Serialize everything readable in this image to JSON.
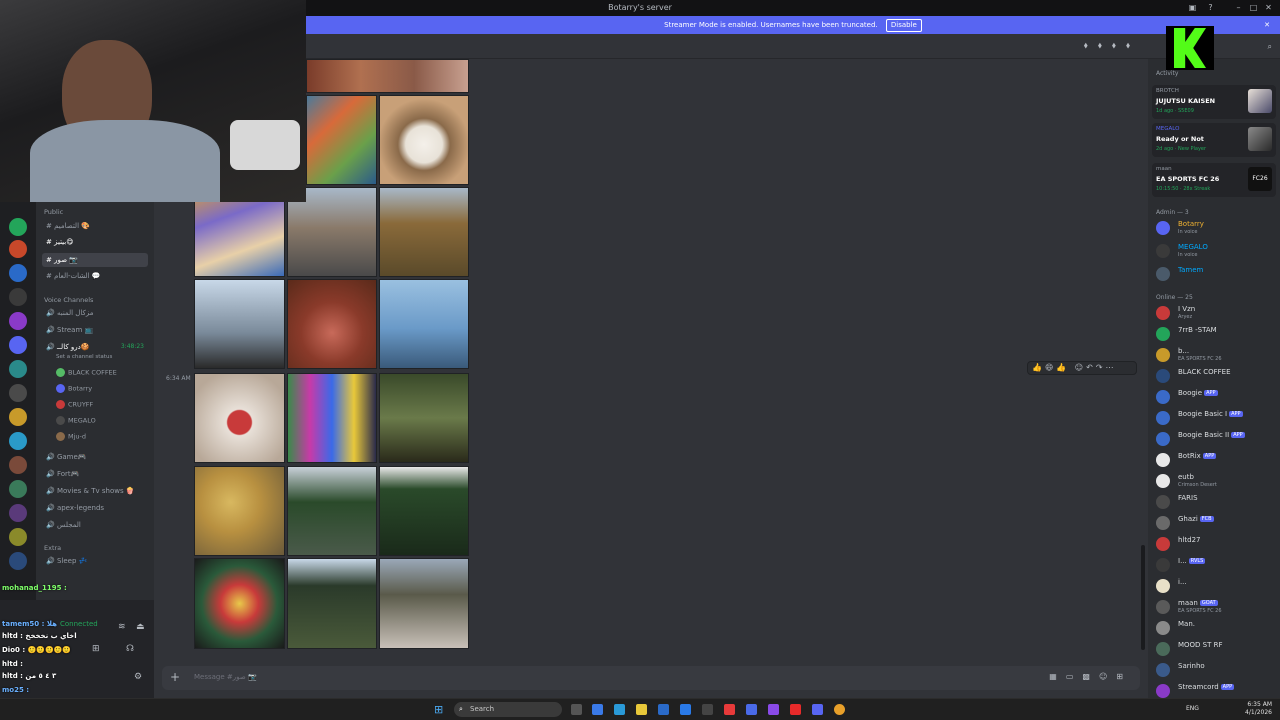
{
  "window": {
    "title": "Botarry's server"
  },
  "banner": {
    "text": "Streamer Mode is enabled. Usernames have been truncated.",
    "button": "Disable"
  },
  "channels": {
    "categories": [
      "Public",
      "Voice Channels",
      "Extra"
    ],
    "text": [
      "التصاميم 🎨",
      "بيتيز😋",
      "صور 📷",
      "الشات-العام 💬"
    ],
    "voice": [
      "مزكال المنبه",
      "Stream 📺",
      "درو كالــ🍪",
      "Game🎮",
      "Fort🎮",
      "Movies & Tv shows 🍿",
      "apex-legends",
      "المجلس",
      "Sleep 💤"
    ],
    "channel_status": "Set a channel status",
    "voice_time": "3:48:23",
    "voice_users": [
      "BLACK COFFEE",
      "Botarry",
      "CRUYFF",
      "MEGALO",
      "Mju-d"
    ]
  },
  "overlay_chat": [
    "mohanad_1195 :",
    "tamem50 : هلا",
    "hltd : اخاي ب نخخخخ",
    "Dio0 : 🙂🙂🙂🙂🙂",
    "hltd :",
    "hltd : ٣ ٤ ٥ من",
    "mo25 :"
  ],
  "user_panel": {
    "status": "Connected"
  },
  "chat": {
    "timestamp": "6:34 AM",
    "composer_placeholder": "Message #صور 📷"
  },
  "members": {
    "activity_label": "Activity",
    "activities": [
      {
        "user": "BROTCH",
        "game": "JUJUTSU KAISEN",
        "sub": "1d ago · S5E09"
      },
      {
        "user": "MEGALO",
        "game": "Ready or Not",
        "sub": "2d ago · New Player"
      },
      {
        "user": "maan",
        "game": "EA SPORTS FC 26",
        "sub": "10:15:50 · 28x Streak"
      }
    ],
    "admin_header": "Admin — 3",
    "admins": [
      {
        "name": "Botarry",
        "sub": "In voice"
      },
      {
        "name": "MEGALO",
        "sub": "In voice"
      },
      {
        "name": "Tamem",
        "sub": ""
      }
    ],
    "online_header": "Online — 25",
    "online": [
      {
        "name": "I Vzn",
        "sub": "Aryez",
        "badge": ""
      },
      {
        "name": "7rrB -STAM",
        "sub": "",
        "badge": ""
      },
      {
        "name": "b...",
        "sub": "EA SPORTS FC 26",
        "badge": ""
      },
      {
        "name": "BLACK COFFEE",
        "sub": "",
        "badge": ""
      },
      {
        "name": "Boogie",
        "sub": "",
        "badge": "APP"
      },
      {
        "name": "Boogie Basic I",
        "sub": "",
        "badge": "APP"
      },
      {
        "name": "Boogie Basic II",
        "sub": "",
        "badge": "APP"
      },
      {
        "name": "BotRix",
        "sub": "",
        "badge": "APP"
      },
      {
        "name": "eutb",
        "sub": "Crimson Desert",
        "badge": ""
      },
      {
        "name": "FARIS",
        "sub": "",
        "badge": ""
      },
      {
        "name": "Ghazi",
        "sub": "",
        "badge": "FCB"
      },
      {
        "name": "hltd27",
        "sub": "",
        "badge": ""
      },
      {
        "name": "I...",
        "sub": "",
        "badge": "RVLS"
      },
      {
        "name": "i...",
        "sub": "",
        "badge": ""
      },
      {
        "name": "maan",
        "sub": "EA SPORTS FC 26",
        "badge": "GOAT"
      },
      {
        "name": "Man.",
        "sub": "",
        "badge": ""
      },
      {
        "name": "MOOD ST RF",
        "sub": "",
        "badge": ""
      },
      {
        "name": "Sarinho",
        "sub": "",
        "badge": ""
      },
      {
        "name": "Streamcord",
        "sub": "",
        "badge": "APP"
      }
    ]
  },
  "taskbar": {
    "search": "Search",
    "lang": "ENG",
    "time": "6:35 AM",
    "date": "4/1/2026"
  },
  "colors": {
    "accent": "#5865f2",
    "online": "#23a55a",
    "kick": "#53fc18"
  }
}
